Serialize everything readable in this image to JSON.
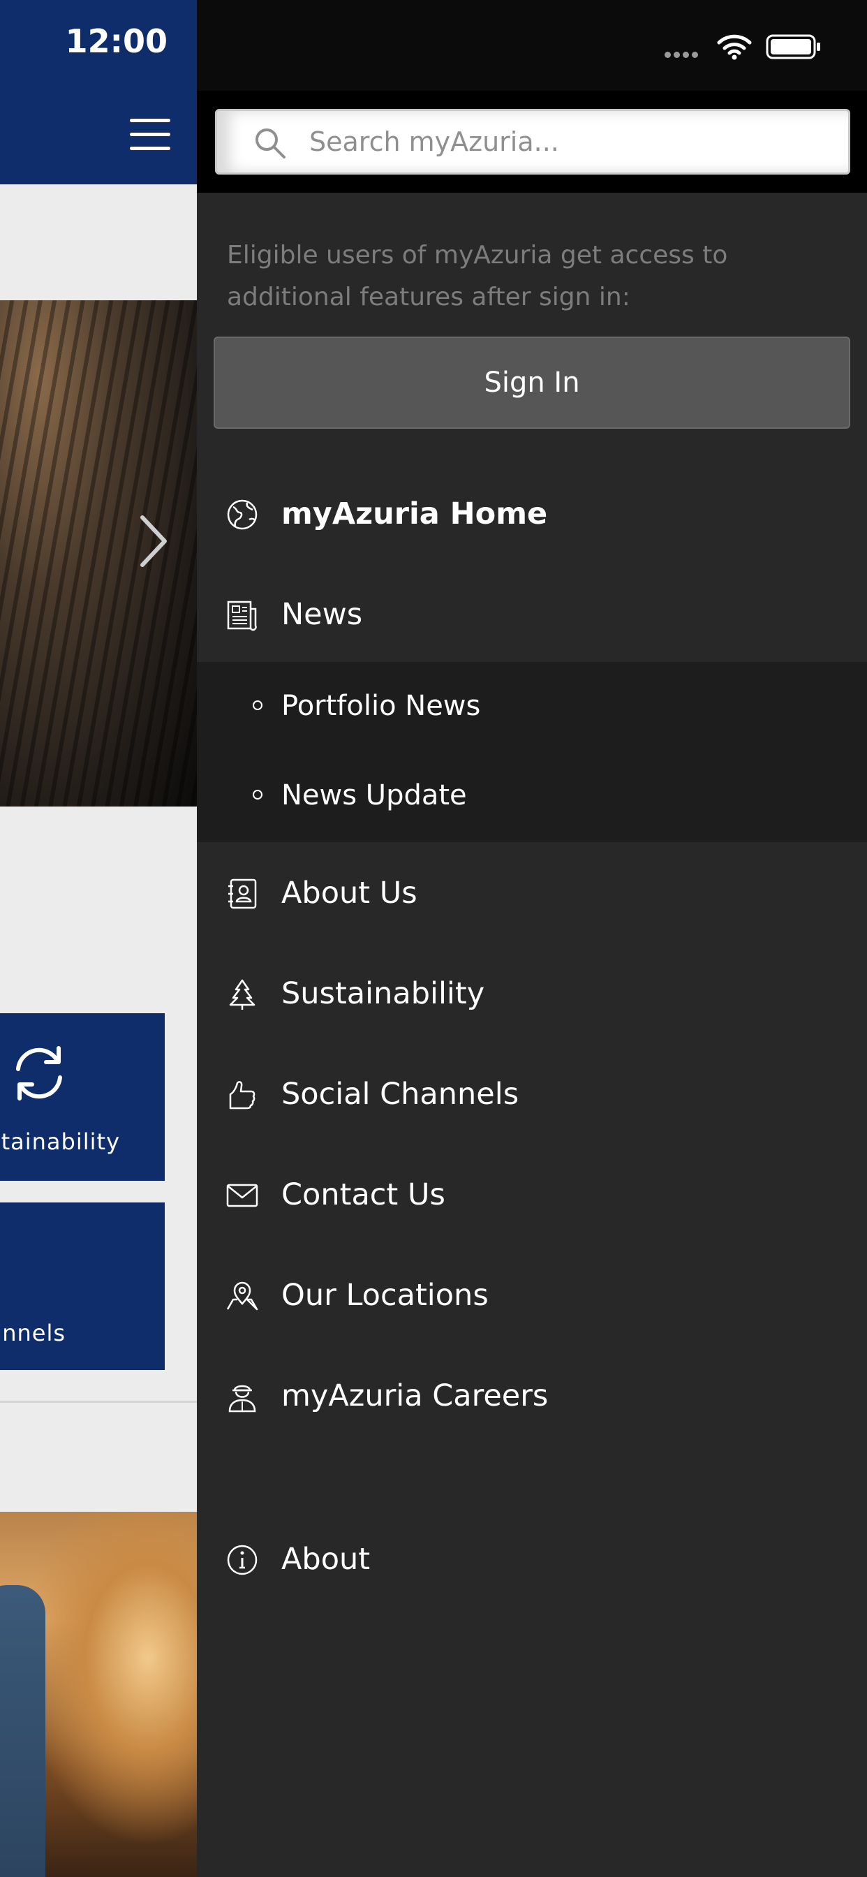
{
  "status_bar": {
    "time": "12:00",
    "icons": [
      "signal-dots-icon",
      "wifi-icon",
      "battery-icon"
    ]
  },
  "background_app": {
    "header_icon": "hamburger-menu-icon",
    "hero_next_icon": "chevron-right-icon",
    "tiles": [
      {
        "label": "stainability",
        "icon": "refresh-icon"
      },
      {
        "label": "nnels"
      }
    ],
    "colors": {
      "header": "#0f2d6b",
      "tile": "#0f2d6b",
      "background": "#ececec"
    }
  },
  "drawer": {
    "search": {
      "placeholder": "Search myAzuria...",
      "value": ""
    },
    "eligible_text": "Eligible users of myAzuria get access to additional features after sign in:",
    "sign_in_label": "Sign In",
    "menu": [
      {
        "label": "myAzuria Home",
        "icon": "globe-icon",
        "active": true
      },
      {
        "label": "News",
        "icon": "newspaper-icon",
        "expanded": true,
        "children": [
          {
            "label": "Portfolio News"
          },
          {
            "label": "News Update"
          }
        ]
      },
      {
        "label": "About Us",
        "icon": "contact-book-icon"
      },
      {
        "label": "Sustainability",
        "icon": "tree-icon"
      },
      {
        "label": "Social Channels",
        "icon": "thumbs-up-icon"
      },
      {
        "label": "Contact Us",
        "icon": "envelope-icon"
      },
      {
        "label": "Our Locations",
        "icon": "map-pin-icon"
      },
      {
        "label": "myAzuria Careers",
        "icon": "worker-icon"
      }
    ],
    "footer_item": {
      "label": "About",
      "icon": "info-icon"
    },
    "colors": {
      "background": "#282828",
      "submenu_background": "#1d1d1d",
      "search_strip": "#000000",
      "sign_in_button": "#565656",
      "muted_text": "#7d7d7d"
    }
  }
}
